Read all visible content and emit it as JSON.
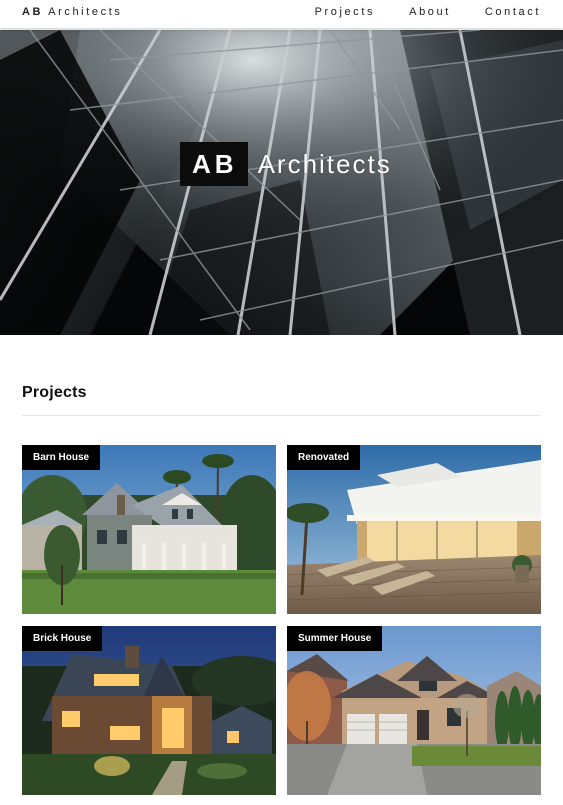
{
  "nav": {
    "brand_bold": "AB",
    "brand_rest": "Architects",
    "links": [
      "Projects",
      "About",
      "Contact"
    ]
  },
  "hero": {
    "title_bold": "AB",
    "title_rest": "Architects"
  },
  "projects": {
    "heading": "Projects",
    "items": [
      {
        "label": "Barn House"
      },
      {
        "label": "Renovated"
      },
      {
        "label": "Brick House"
      },
      {
        "label": "Summer House"
      }
    ]
  }
}
